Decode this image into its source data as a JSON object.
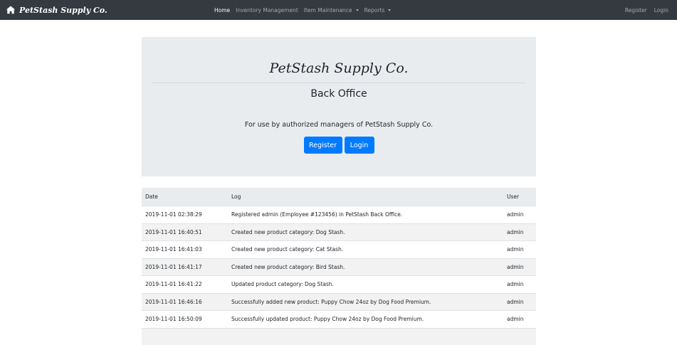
{
  "navbar": {
    "brand": "PetStash Supply Co.",
    "brand_icon": "home-icon",
    "links": [
      {
        "label": "Home",
        "active": true
      },
      {
        "label": "Inventory Management",
        "active": false
      },
      {
        "label": "Item Maintenance",
        "active": false,
        "dropdown": true
      },
      {
        "label": "Reports",
        "active": false,
        "dropdown": true
      }
    ],
    "right_links": [
      {
        "label": "Register"
      },
      {
        "label": "Login"
      }
    ]
  },
  "jumbotron": {
    "title": "PetStash Supply Co.",
    "subtitle": "Back Office",
    "description": "For use by authorized managers of PetStash Supply Co.",
    "register_button": "Register",
    "login_button": "Login"
  },
  "log_table": {
    "headers": [
      "Date",
      "Log",
      "User"
    ],
    "rows": [
      [
        "2019-11-01 02:38:29",
        "Registered admin (Employee #123456) in PetStash Back Office.",
        "admin"
      ],
      [
        "2019-11-01 16:40:51",
        "Created new product category: Dog Stash.",
        "admin"
      ],
      [
        "2019-11-01 16:41:03",
        "Created new product category: Cat Stash.",
        "admin"
      ],
      [
        "2019-11-01 16:41:17",
        "Created new product category: Bird Stash.",
        "admin"
      ],
      [
        "2019-11-01 16:41:22",
        "Updated product category: Dog Stash.",
        "admin"
      ],
      [
        "2019-11-01 16:46:16",
        "Successfully added new product: Puppy Chow 24oz by Dog Food Premium.",
        "admin"
      ],
      [
        "2019-11-01 16:50:09",
        "Successfully updated product: Puppy Chow 24oz by Dog Food Premium.",
        "admin"
      ]
    ]
  },
  "colors": {
    "navbar_bg": "#343a40",
    "primary": "#007bff",
    "jumbotron_bg": "#e9ecef"
  }
}
